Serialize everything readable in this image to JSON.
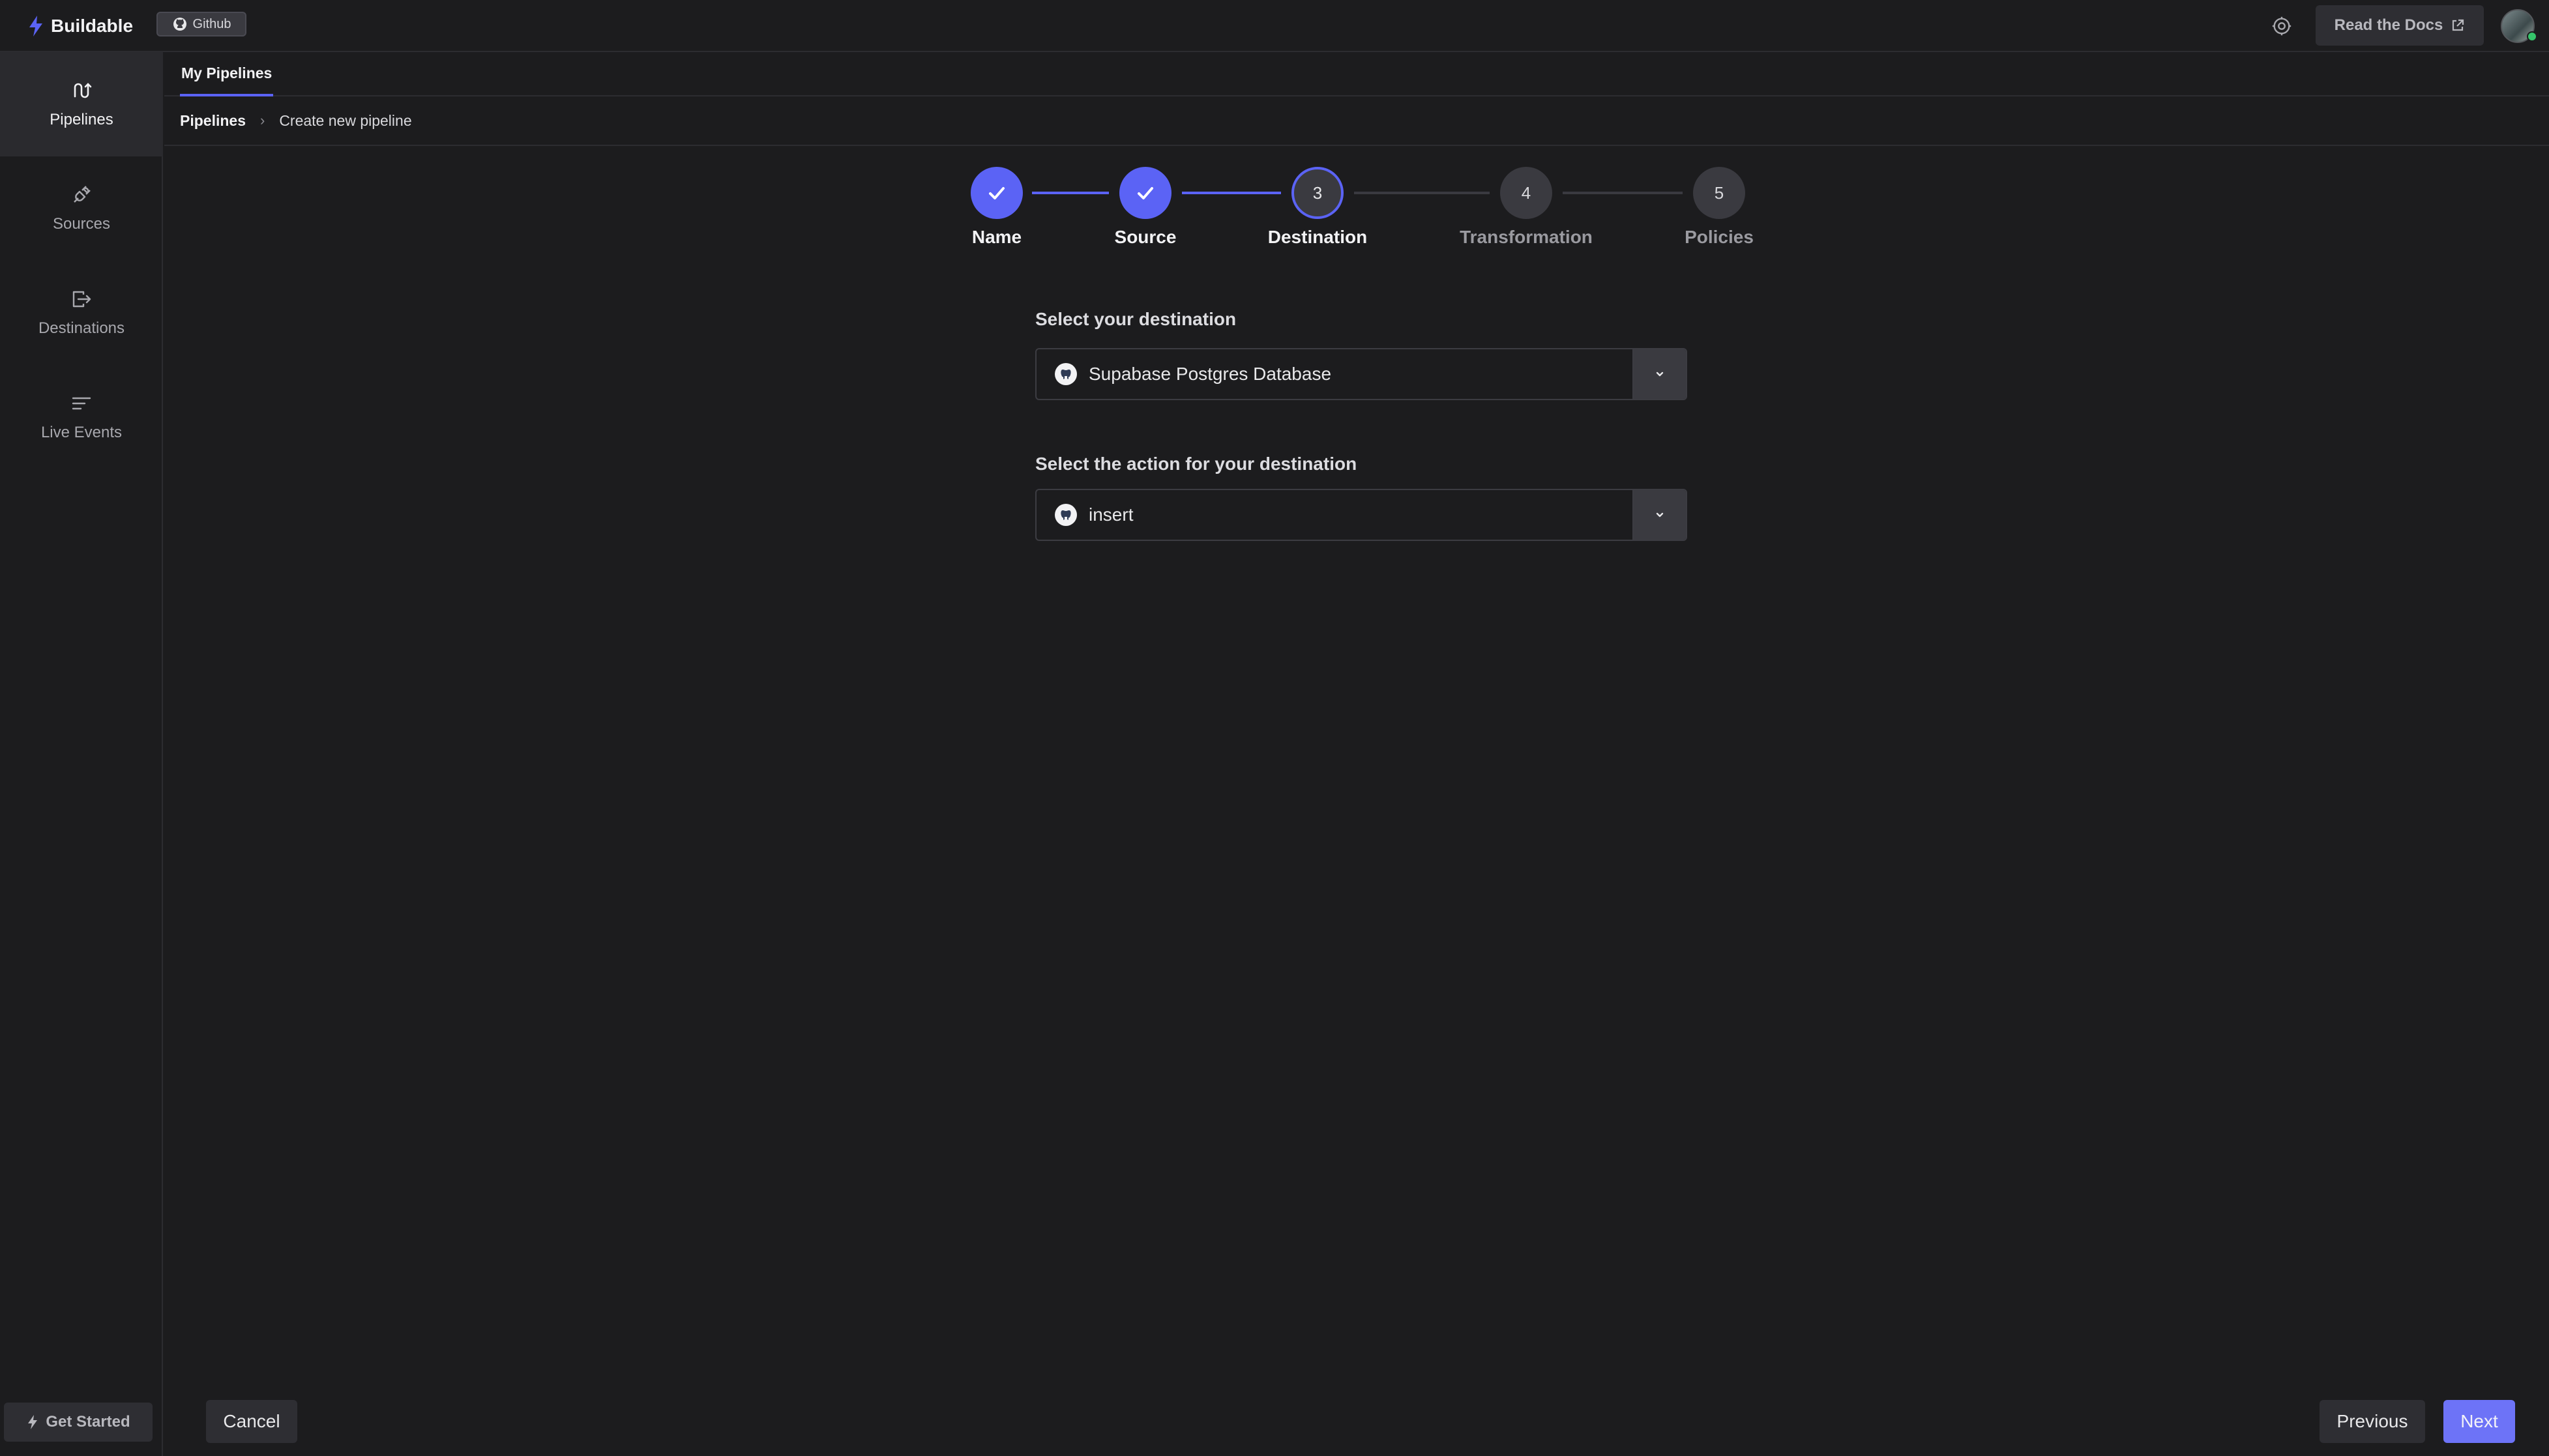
{
  "app": {
    "brand_name": "Buildable",
    "github_label": "Github",
    "docs_label": "Read the Docs"
  },
  "sidebar": {
    "items": [
      {
        "label": "Pipelines",
        "icon": "pipeline-icon",
        "active": true
      },
      {
        "label": "Sources",
        "icon": "plug-icon",
        "active": false
      },
      {
        "label": "Destinations",
        "icon": "export-icon",
        "active": false
      },
      {
        "label": "Live Events",
        "icon": "lines-icon",
        "active": false
      }
    ],
    "get_started_label": "Get Started"
  },
  "tabs": [
    {
      "label": "My Pipelines",
      "active": true
    }
  ],
  "breadcrumb": {
    "root": "Pipelines",
    "separator": "›",
    "current": "Create new pipeline"
  },
  "stepper": {
    "steps": [
      {
        "number": "1",
        "label": "Name",
        "state": "done"
      },
      {
        "number": "2",
        "label": "Source",
        "state": "done"
      },
      {
        "number": "3",
        "label": "Destination",
        "state": "current"
      },
      {
        "number": "4",
        "label": "Transformation",
        "state": "todo"
      },
      {
        "number": "5",
        "label": "Policies",
        "state": "todo"
      }
    ]
  },
  "form": {
    "destination_label": "Select your destination",
    "destination_value": "Supabase Postgres Database",
    "action_label": "Select the action for your destination",
    "action_value": "insert"
  },
  "footer": {
    "cancel_label": "Cancel",
    "previous_label": "Previous",
    "next_label": "Next"
  },
  "colors": {
    "accent": "#5b63f5",
    "background": "#1c1c1e",
    "status_online": "#35c46a"
  }
}
